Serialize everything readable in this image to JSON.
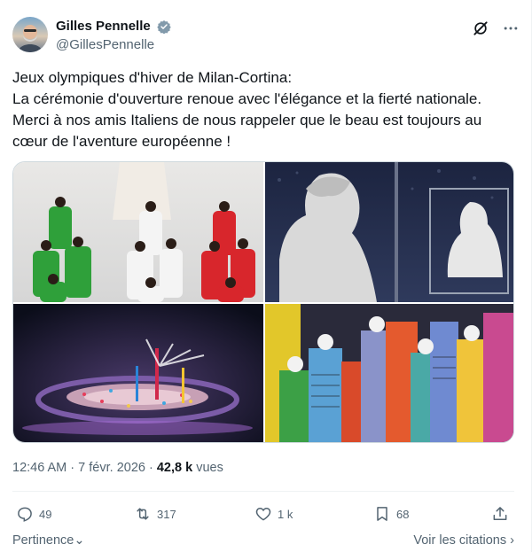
{
  "author": {
    "display_name": "Gilles Pennelle",
    "handle": "@GillesPennelle",
    "verified": true,
    "avatar_icon": "user-avatar"
  },
  "tweet": {
    "lines": [
      "Jeux olympiques d'hiver de Milan-Cortina:",
      "La cérémonie d'ouverture renoue avec l'élégance et la fierté nationale.",
      "Merci à nos amis Italiens de nous rappeler que le beau est toujours au",
      "cœur de l'aventure européenne !"
    ]
  },
  "media": {
    "count": 4
  },
  "meta": {
    "time": "12:46 AM",
    "separator": "·",
    "date": "7 févr. 2026",
    "views_count": "42,8 k",
    "views_label": "vues"
  },
  "actions": {
    "replies": "49",
    "reposts": "317",
    "likes": "1 k",
    "bookmarks": "68"
  },
  "footer": {
    "sort_label": "Pertinence",
    "quotes_label": "Voir les citations"
  },
  "colors": {
    "text": "#0f1419",
    "secondary": "#536471",
    "verified": "#829aab",
    "border": "#eff3f4"
  }
}
